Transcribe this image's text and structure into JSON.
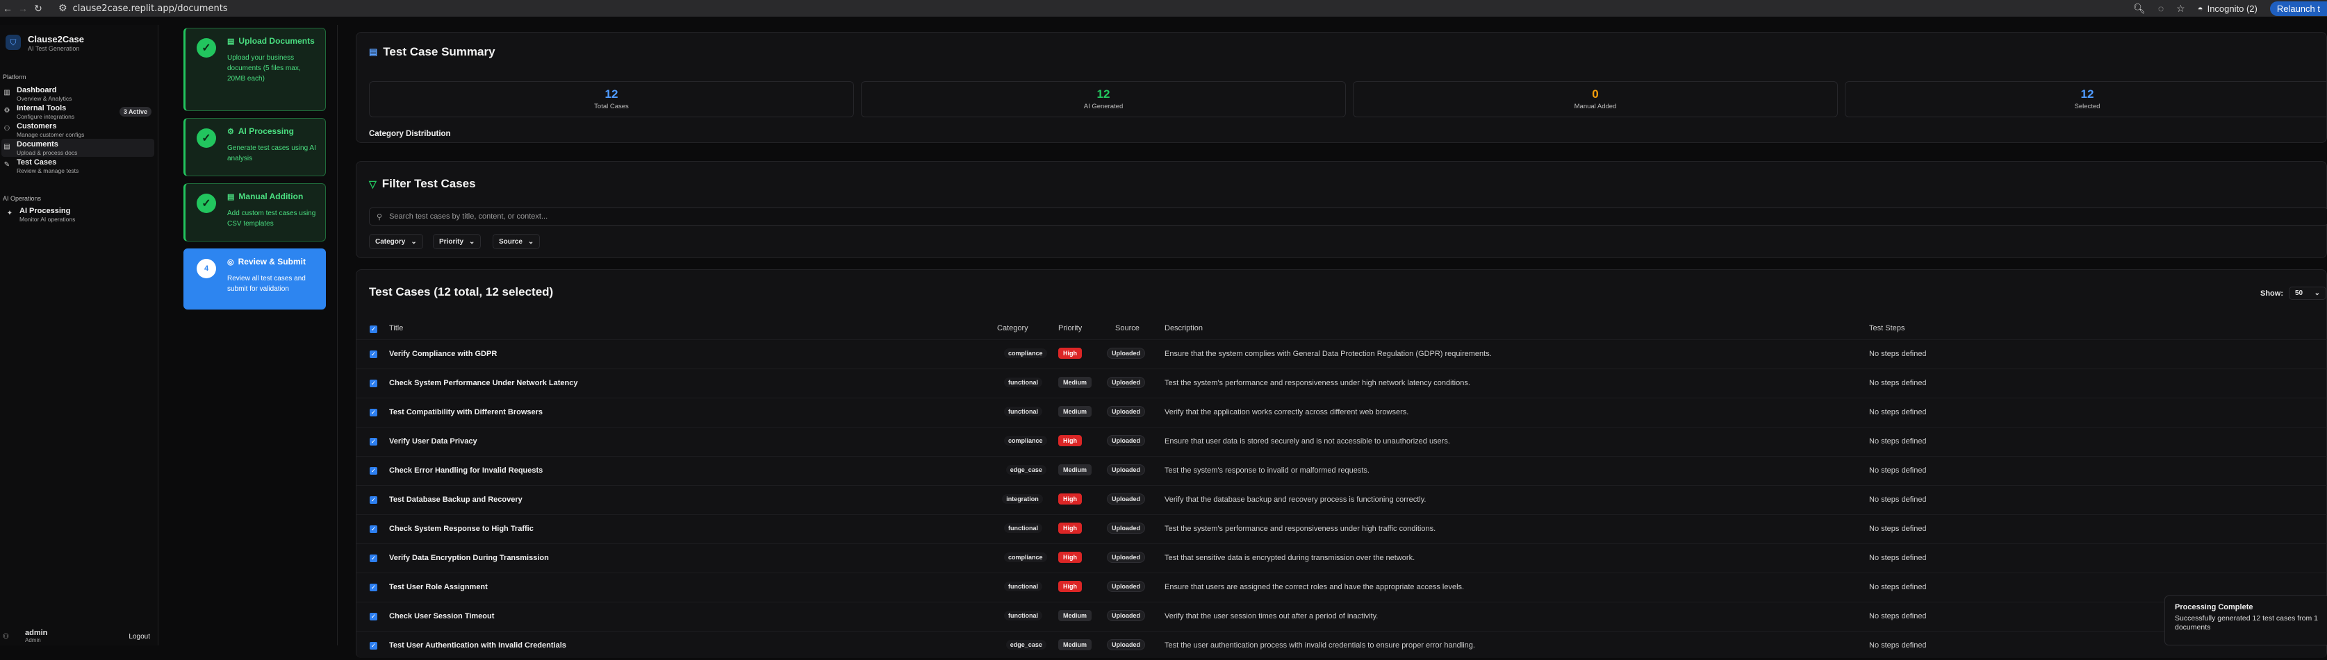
{
  "browser": {
    "url": "clause2case.replit.app/documents",
    "incognito_label": "Incognito (2)",
    "relaunch_label": "Relaunch t"
  },
  "sidebar": {
    "brand_name": "Clause2Case",
    "brand_sub": "AI Test Generation",
    "platform_label": "Platform",
    "items": [
      {
        "title": "Dashboard",
        "sub": "Overview & Analytics",
        "icon": "chart-icon"
      },
      {
        "title": "Internal Tools",
        "sub": "Configure integrations",
        "icon": "tools-icon",
        "badge": "3 Active"
      },
      {
        "title": "Customers",
        "sub": "Manage customer configs",
        "icon": "users-icon"
      },
      {
        "title": "Documents",
        "sub": "Upload & process docs",
        "icon": "document-icon"
      },
      {
        "title": "Test Cases",
        "sub": "Review & manage tests",
        "icon": "pencil-icon"
      }
    ],
    "ai_ops_label": "AI Operations",
    "ai_item": {
      "title": "AI Processing",
      "sub": "Monitor AI operations",
      "icon": "sparkle-icon"
    },
    "user_name": "admin",
    "user_role": "Admin",
    "logout_label": "Logout"
  },
  "steps": [
    {
      "title": "Upload Documents",
      "desc": "Upload your business documents (5 files max, 20MB each)",
      "status": "done"
    },
    {
      "title": "AI Processing",
      "desc": "Generate test cases using AI analysis",
      "status": "done"
    },
    {
      "title": "Manual Addition",
      "desc": "Add custom test cases using CSV templates",
      "status": "done"
    },
    {
      "title": "Review & Submit",
      "desc": "Review all test cases and submit for validation",
      "status": "current",
      "number": "4"
    }
  ],
  "summary": {
    "title": "Test Case Summary",
    "stats": [
      {
        "value": "12",
        "label": "Total Cases",
        "color": "#4f9bff"
      },
      {
        "value": "12",
        "label": "AI Generated",
        "color": "#22c55e"
      },
      {
        "value": "0",
        "label": "Manual Added",
        "color": "#f59e0b"
      },
      {
        "value": "12",
        "label": "Selected",
        "color": "#4f9bff"
      }
    ],
    "category_distribution_label": "Category Distribution"
  },
  "filter": {
    "title": "Filter Test Cases",
    "search_placeholder": "Search test cases by title, content, or context...",
    "category_label": "Category",
    "priority_label": "Priority",
    "source_label": "Source"
  },
  "table": {
    "title": "Test Cases (12 total, 12 selected)",
    "show_label": "Show:",
    "show_value": "50",
    "headers": {
      "title": "Title",
      "category": "Category",
      "priority": "Priority",
      "source": "Source",
      "description": "Description",
      "steps": "Test Steps"
    },
    "rows": [
      {
        "title": "Verify Compliance with GDPR",
        "category": "compliance",
        "priority": "High",
        "source": "Uploaded",
        "description": "Ensure that the system complies with General Data Protection Regulation (GDPR) requirements.",
        "steps": "No steps defined"
      },
      {
        "title": "Check System Performance Under Network Latency",
        "category": "functional",
        "priority": "Medium",
        "source": "Uploaded",
        "description": "Test the system's performance and responsiveness under high network latency conditions.",
        "steps": "No steps defined"
      },
      {
        "title": "Test Compatibility with Different Browsers",
        "category": "functional",
        "priority": "Medium",
        "source": "Uploaded",
        "description": "Verify that the application works correctly across different web browsers.",
        "steps": "No steps defined"
      },
      {
        "title": "Verify User Data Privacy",
        "category": "compliance",
        "priority": "High",
        "source": "Uploaded",
        "description": "Ensure that user data is stored securely and is not accessible to unauthorized users.",
        "steps": "No steps defined"
      },
      {
        "title": "Check Error Handling for Invalid Requests",
        "category": "edge_case",
        "priority": "Medium",
        "source": "Uploaded",
        "description": "Test the system's response to invalid or malformed requests.",
        "steps": "No steps defined"
      },
      {
        "title": "Test Database Backup and Recovery",
        "category": "integration",
        "priority": "High",
        "source": "Uploaded",
        "description": "Verify that the database backup and recovery process is functioning correctly.",
        "steps": "No steps defined"
      },
      {
        "title": "Check System Response to High Traffic",
        "category": "functional",
        "priority": "High",
        "source": "Uploaded",
        "description": "Test the system's performance and responsiveness under high traffic conditions.",
        "steps": "No steps defined"
      },
      {
        "title": "Verify Data Encryption During Transmission",
        "category": "compliance",
        "priority": "High",
        "source": "Uploaded",
        "description": "Test that sensitive data is encrypted during transmission over the network.",
        "steps": "No steps defined"
      },
      {
        "title": "Test User Role Assignment",
        "category": "functional",
        "priority": "High",
        "source": "Uploaded",
        "description": "Ensure that users are assigned the correct roles and have the appropriate access levels.",
        "steps": "No steps defined"
      },
      {
        "title": "Check User Session Timeout",
        "category": "functional",
        "priority": "Medium",
        "source": "Uploaded",
        "description": "Verify that the user session times out after a period of inactivity.",
        "steps": "No steps defined"
      },
      {
        "title": "Test User Authentication with Invalid Credentials",
        "category": "edge_case",
        "priority": "Medium",
        "source": "Uploaded",
        "description": "Test the user authentication process with invalid credentials to ensure proper error handling.",
        "steps": "No steps defined"
      }
    ]
  },
  "toast": {
    "title": "Processing Complete",
    "desc": "Successfully generated 12 test cases from 1 documents"
  }
}
